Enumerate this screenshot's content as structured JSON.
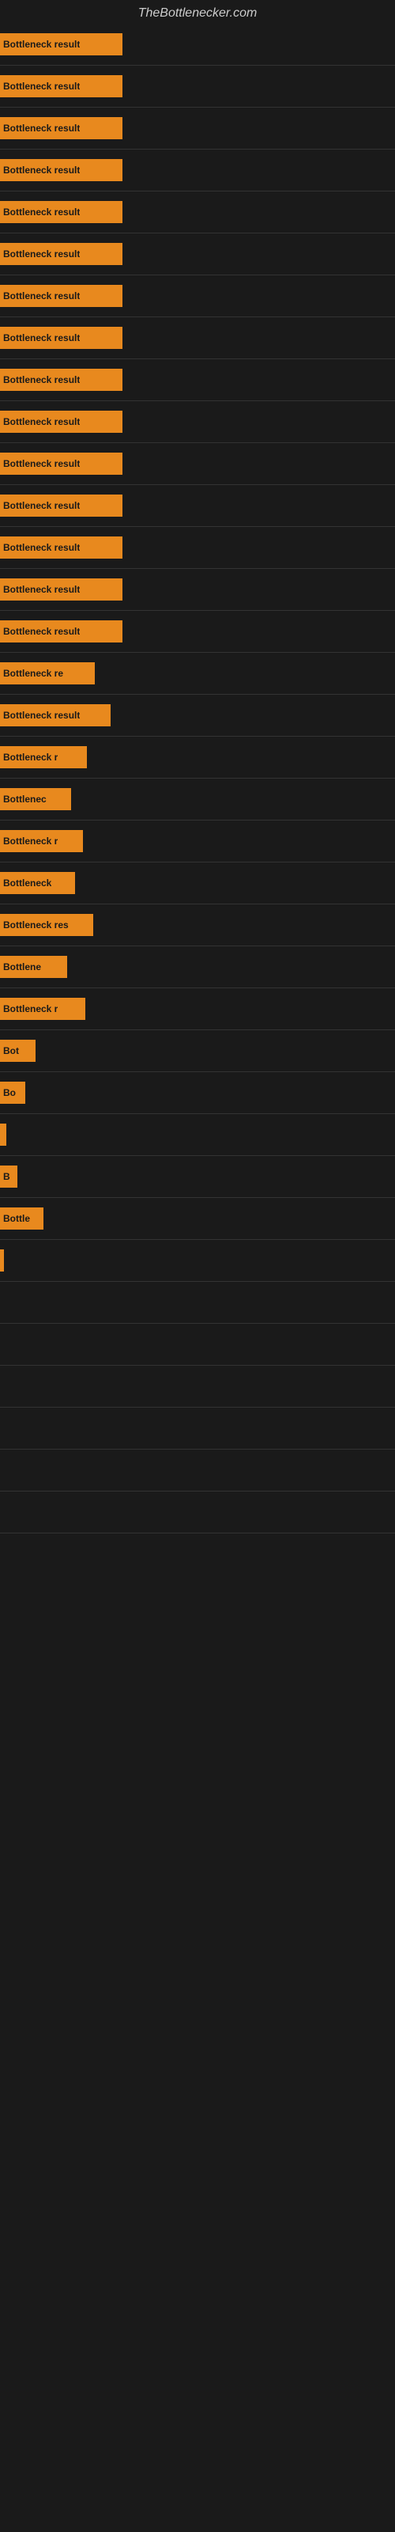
{
  "site": {
    "title": "TheBottlenecker.com"
  },
  "bars": [
    {
      "label": "Bottleneck result",
      "width": 155
    },
    {
      "label": "Bottleneck result",
      "width": 155
    },
    {
      "label": "Bottleneck result",
      "width": 155
    },
    {
      "label": "Bottleneck result",
      "width": 155
    },
    {
      "label": "Bottleneck result",
      "width": 155
    },
    {
      "label": "Bottleneck result",
      "width": 155
    },
    {
      "label": "Bottleneck result",
      "width": 155
    },
    {
      "label": "Bottleneck result",
      "width": 155
    },
    {
      "label": "Bottleneck result",
      "width": 155
    },
    {
      "label": "Bottleneck result",
      "width": 155
    },
    {
      "label": "Bottleneck result",
      "width": 155
    },
    {
      "label": "Bottleneck result",
      "width": 155
    },
    {
      "label": "Bottleneck result",
      "width": 155
    },
    {
      "label": "Bottleneck result",
      "width": 155
    },
    {
      "label": "Bottleneck result",
      "width": 155
    },
    {
      "label": "Bottleneck re",
      "width": 120
    },
    {
      "label": "Bottleneck result",
      "width": 140
    },
    {
      "label": "Bottleneck r",
      "width": 110
    },
    {
      "label": "Bottlenec",
      "width": 90
    },
    {
      "label": "Bottleneck r",
      "width": 105
    },
    {
      "label": "Bottleneck",
      "width": 95
    },
    {
      "label": "Bottleneck res",
      "width": 118
    },
    {
      "label": "Bottlene",
      "width": 85
    },
    {
      "label": "Bottleneck r",
      "width": 108
    },
    {
      "label": "Bot",
      "width": 45
    },
    {
      "label": "Bo",
      "width": 32
    },
    {
      "label": "",
      "width": 8
    },
    {
      "label": "B",
      "width": 22
    },
    {
      "label": "Bottle",
      "width": 55
    },
    {
      "label": "",
      "width": 5
    },
    {
      "label": "",
      "width": 0
    },
    {
      "label": "",
      "width": 0
    },
    {
      "label": "",
      "width": 0
    },
    {
      "label": "",
      "width": 0
    },
    {
      "label": "",
      "width": 0
    },
    {
      "label": "",
      "width": 0
    }
  ]
}
